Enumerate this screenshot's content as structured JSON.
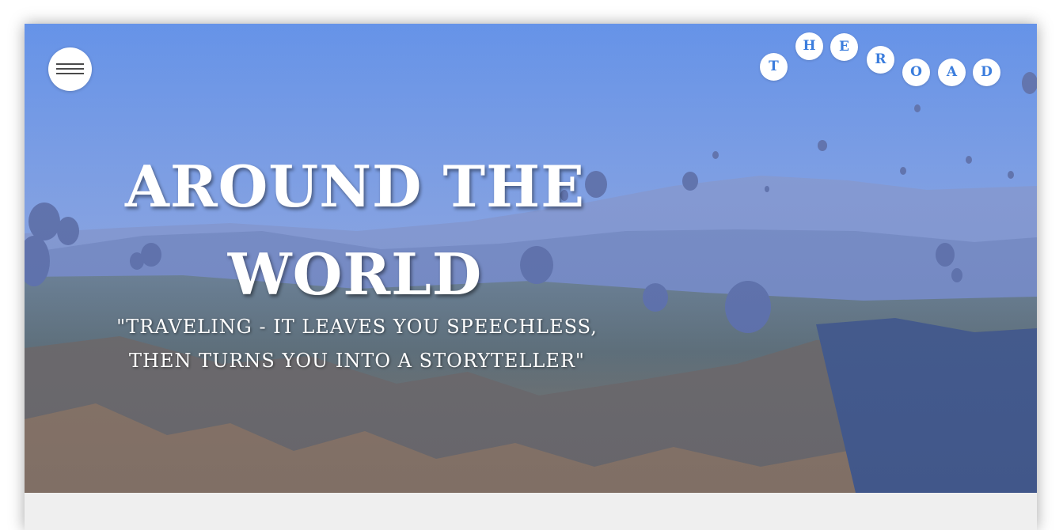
{
  "hero": {
    "title_line1": "AROUND THE",
    "title_line2": "WORLD",
    "quote_line1": "\"TRAVELING - IT LEAVES YOU SPEECHLESS,",
    "quote_line2": "THEN TURNS YOU INTO A STORYTELLER\"",
    "background_image": "hot-air-balloons-over-valley",
    "overlay_color": "#3b6ef0"
  },
  "menu": {
    "icon": "hamburger-menu-icon"
  },
  "logo": {
    "letters": [
      "T",
      "H",
      "E",
      "R",
      "O",
      "A",
      "D"
    ],
    "color": "#3b7ddd"
  }
}
